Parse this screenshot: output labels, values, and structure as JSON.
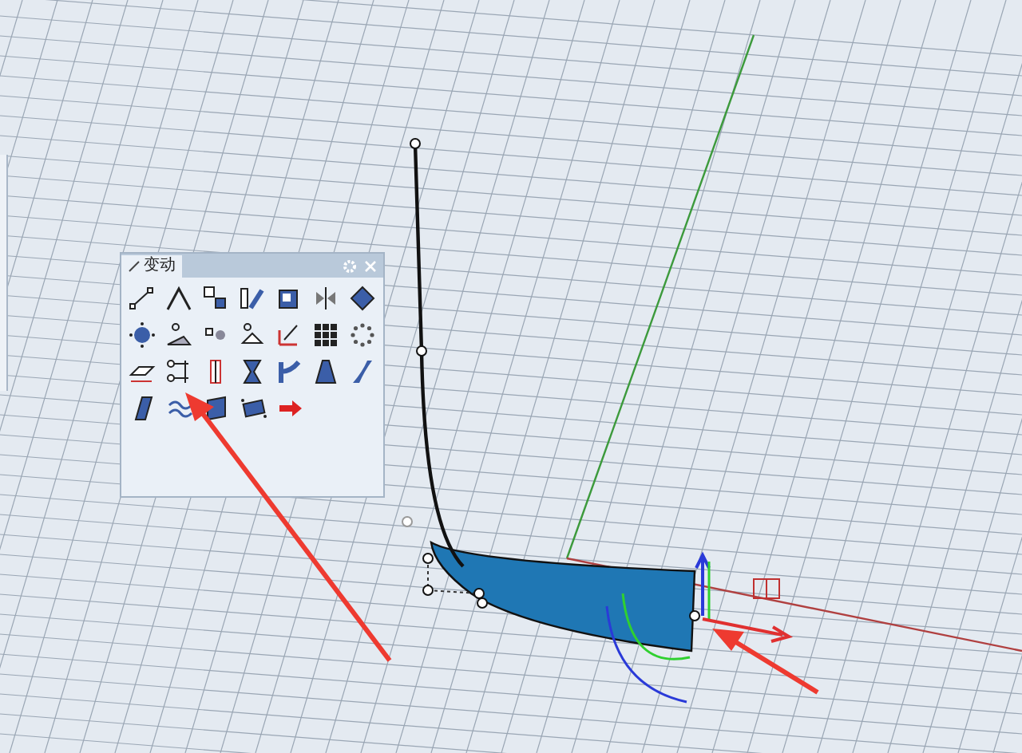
{
  "viewport": {
    "toolbar": {
      "title": "变动"
    }
  }
}
